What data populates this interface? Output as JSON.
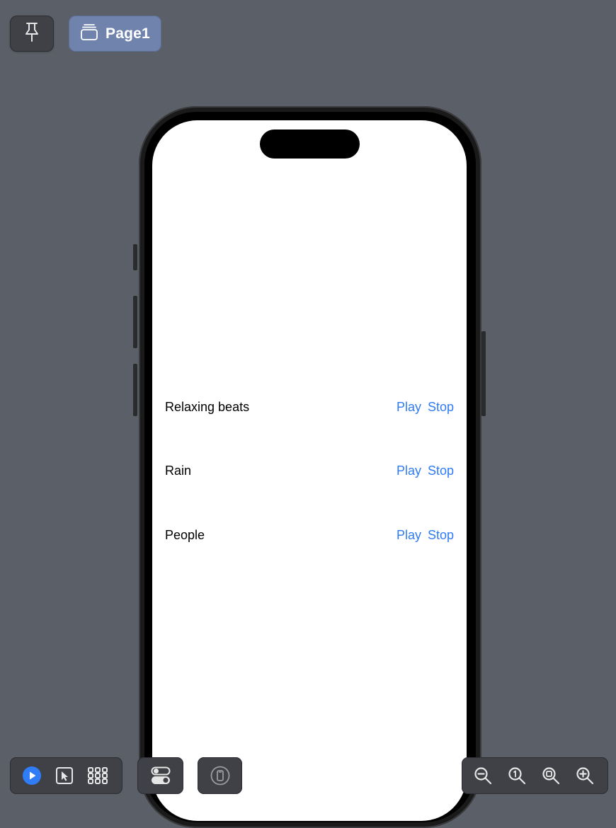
{
  "top_bar": {
    "pin_icon": "pin-icon",
    "page_icon": "pages-stack-icon",
    "page_label": "Page1"
  },
  "preview": {
    "sounds": [
      {
        "name": "Relaxing beats",
        "play_label": "Play",
        "stop_label": "Stop"
      },
      {
        "name": "Rain",
        "play_label": "Play",
        "stop_label": "Stop"
      },
      {
        "name": "People",
        "play_label": "Play",
        "stop_label": "Stop"
      }
    ]
  },
  "bottom_bar": {
    "left_group": [
      "play-icon",
      "select-cursor-icon",
      "grid-icon"
    ],
    "variants_icon": "toggles-icon",
    "device_icon": "device-settings-icon",
    "zoom_group": [
      "zoom-out-icon",
      "zoom-100-icon",
      "zoom-fit-icon",
      "zoom-in-icon"
    ]
  },
  "colors": {
    "background": "#5b5f67",
    "accent_link": "#2f7cf6",
    "play_button": "#2f7cf6",
    "page_button": "#6f83ad"
  }
}
